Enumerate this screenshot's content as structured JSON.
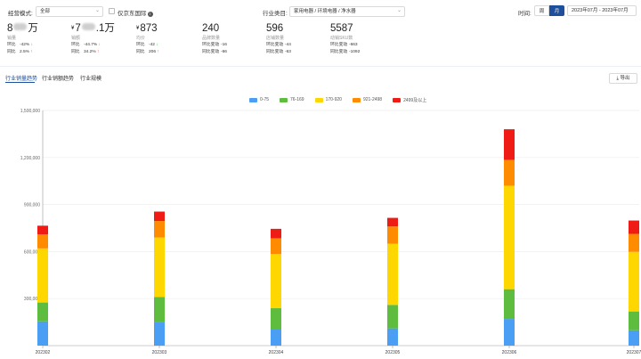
{
  "filters": {
    "mode_label": "经营模式:",
    "mode_value": "全部",
    "jd_intl_label": "仅京东国际",
    "industry_label": "行业类目:",
    "industry_value": "家用电器 / 环境电器 / 净水器",
    "time_label": "时间:",
    "week_label": "周",
    "month_label": "月",
    "date_range": "2023年07月 - 2023年07月"
  },
  "metrics": [
    {
      "value_prefix": "8",
      "value_suffix": "万",
      "name": "销量",
      "r1_label": "环比",
      "r1_value": "-42%",
      "r1_dir": "down",
      "r2_label": "同比",
      "r2_value": "2.5%",
      "r2_dir": "up"
    },
    {
      "currency": "¥",
      "value_prefix": "7",
      "value_suffix": ".1万",
      "name": "销额",
      "r1_label": "环比",
      "r1_value": "-44.7%",
      "r1_dir": "down",
      "r2_label": "同比",
      "r2_value": "34.2%",
      "r2_dir": "up"
    },
    {
      "currency": "¥",
      "value": "873",
      "name": "均价",
      "r1_label": "环比",
      "r1_value": "-42",
      "r1_dir": "down",
      "r2_label": "同比",
      "r2_value": "206",
      "r2_dir": "up"
    },
    {
      "value": "240",
      "name": "品牌数量",
      "r1_label": "环比变动",
      "r1_value": "-16",
      "r2_label": "同比变动",
      "r2_value": "-66"
    },
    {
      "value": "596",
      "name": "店铺数量",
      "r1_label": "环比变动",
      "r1_value": "-44",
      "r2_label": "同比变动",
      "r2_value": "-63"
    },
    {
      "value": "5587",
      "name": "动销SKU数",
      "r1_label": "环比变动",
      "r1_value": "-663",
      "r2_label": "同比变动",
      "r2_value": "-1092"
    }
  ],
  "tabs": [
    "行业销量趋势",
    "行业销额趋势",
    "行业规模"
  ],
  "export_label": "导出",
  "icons": {
    "export": "export-icon",
    "info": "info-icon",
    "dropdown": "chevron-down-icon"
  },
  "chart_data": {
    "type": "bar",
    "stacked": true,
    "categories": [
      "202302",
      "202303",
      "202304",
      "202305",
      "202306",
      "202307"
    ],
    "series": [
      {
        "name": "0-75",
        "color": "#4a9ff5",
        "values": [
          155000,
          150000,
          105000,
          110000,
          170000,
          98000
        ]
      },
      {
        "name": "76-169",
        "color": "#5ebd3e",
        "values": [
          120000,
          160000,
          135000,
          150000,
          190000,
          120000
        ]
      },
      {
        "name": "170-920",
        "color": "#ffd700",
        "values": [
          345000,
          380000,
          345000,
          390000,
          660000,
          380000
        ]
      },
      {
        "name": "921-2498",
        "color": "#ff8c00",
        "values": [
          90000,
          105000,
          100000,
          110000,
          165000,
          115000
        ]
      },
      {
        "name": "2499及以上",
        "color": "#ee1c14",
        "values": [
          55000,
          60000,
          60000,
          55000,
          195000,
          85000
        ]
      }
    ],
    "yticks": [
      "300,000",
      "600,000",
      "900,000",
      "1,200,000",
      "1,500,000"
    ],
    "ylim": [
      0,
      1500000
    ],
    "legend_position": "top-center",
    "grid": true
  }
}
